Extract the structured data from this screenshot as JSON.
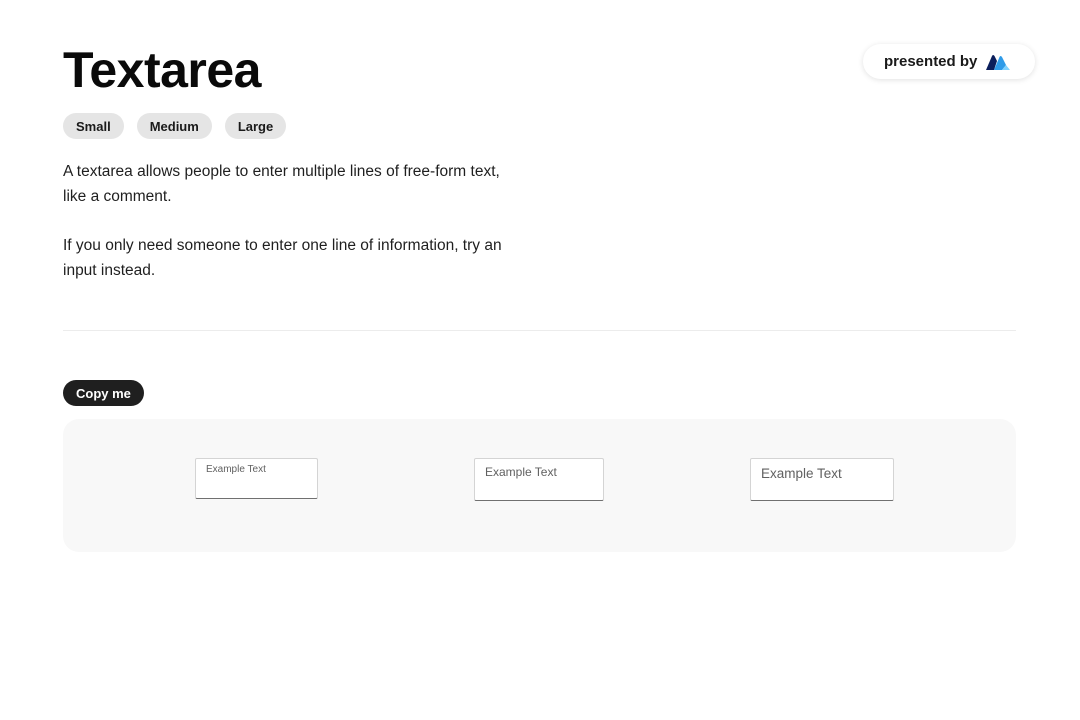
{
  "page": {
    "title": "Textarea"
  },
  "badge": {
    "label": "presented by",
    "logo_icon": "fluent-logo-icon"
  },
  "sizes": [
    {
      "label": "Small"
    },
    {
      "label": "Medium"
    },
    {
      "label": "Large"
    }
  ],
  "description": {
    "paragraph1": "A textarea allows people to enter multiple lines of free-form text, like a comment.",
    "paragraph2": "If you only need someone to enter one line of information, try an input instead."
  },
  "copy_button": {
    "label": "Copy me"
  },
  "examples": [
    {
      "placeholder": "Example Text",
      "size": "small"
    },
    {
      "placeholder": "Example Text",
      "size": "medium"
    },
    {
      "placeholder": "Example Text",
      "size": "large"
    }
  ],
  "colors": {
    "tag_bg": "#e5e5e5",
    "copy_bg": "#1f1f1f",
    "demo_bg": "#f8f8f8",
    "logo_dark": "#0b1f5c",
    "logo_blue": "#2f9be8",
    "logo_light": "#7fd2ff"
  }
}
